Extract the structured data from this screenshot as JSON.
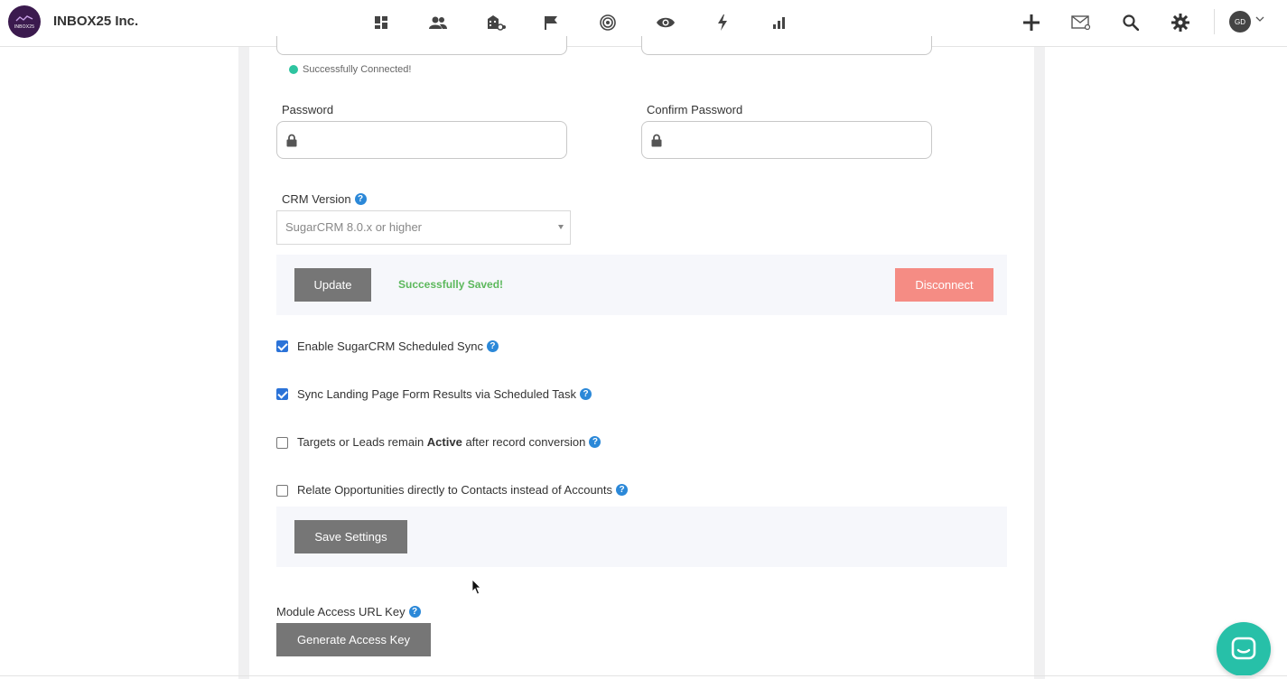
{
  "header": {
    "logo_text": "INBOX25",
    "company": "INBOX25 Inc.",
    "nav_icons": [
      "dashboard-icon",
      "contacts-icon",
      "accounts-icon",
      "campaigns-flag-icon",
      "target-icon",
      "visibility-eye-icon",
      "automation-bolt-icon",
      "reports-bars-icon"
    ],
    "right_icons": [
      "add-icon",
      "mail-icon",
      "search-icon",
      "settings-gear-icon"
    ],
    "avatar_initials": "GD"
  },
  "connection": {
    "status_text": "Successfully Connected!",
    "status_color": "#2ec4a0"
  },
  "fields": {
    "password_label": "Password",
    "confirm_password_label": "Confirm Password",
    "crm_version_label": "CRM Version",
    "crm_version_value": "SugarCRM 8.0.x or higher"
  },
  "actions": {
    "update_label": "Update",
    "saved_message": "Successfully Saved!",
    "disconnect_label": "Disconnect"
  },
  "options": [
    {
      "label": "Enable SugarCRM Scheduled Sync",
      "checked": true
    },
    {
      "label": "Sync Landing Page Form Results via Scheduled Task",
      "checked": true
    },
    {
      "label_pre": "Targets or Leads remain ",
      "label_bold": "Active",
      "label_post": " after record conversion",
      "checked": false
    },
    {
      "label": "Relate Opportunities directly to Contacts instead of Accounts",
      "checked": false
    }
  ],
  "save_settings_label": "Save Settings",
  "module_access": {
    "label": "Module Access URL Key",
    "button_label": "Generate Access Key"
  },
  "help_glyph": "?",
  "colors": {
    "accent_blue": "#2b73d8",
    "success_green": "#5cb85c",
    "danger": "#f58c84",
    "chat_teal": "#27c0a8"
  }
}
